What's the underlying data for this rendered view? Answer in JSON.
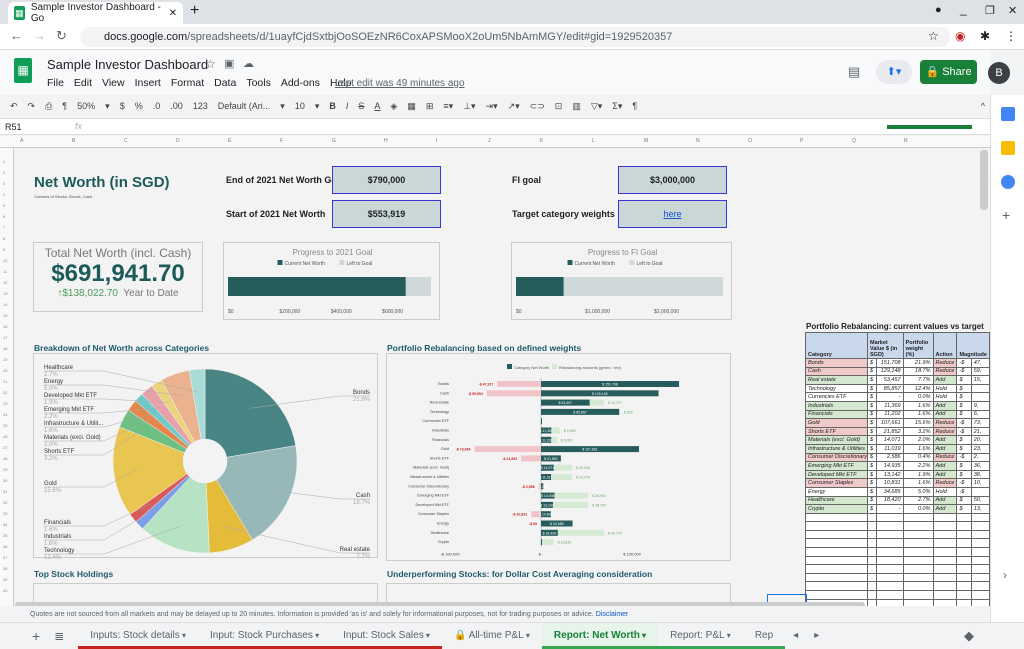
{
  "browser": {
    "tab_title": "Sample Investor Dashboard - Go",
    "url_host": "docs.google.com",
    "url_path": "/spreadsheets/d/1uayfCjdSxtbjOoSOEzNR6CoxAPSMooX2oUm5NbAmMGY/edit#gid=1929520357"
  },
  "doc": {
    "title": "Sample Investor Dashboard",
    "menu": [
      "File",
      "Edit",
      "View",
      "Insert",
      "Format",
      "Data",
      "Tools",
      "Add-ons",
      "Help"
    ],
    "last_edit": "Last edit was 49 minutes ago",
    "share": "Share",
    "avatar": "B"
  },
  "toolbar": {
    "zoom": "50%",
    "currency": "$",
    "percent": "%",
    "dec_less": ".0",
    "dec_more": ".00",
    "format": "123",
    "font": "Default (Ari...",
    "size": "10",
    "bold": "B",
    "italic": "I",
    "strike": "S",
    "textcolor": "A"
  },
  "formula": {
    "cell": "R51",
    "fx": "fx"
  },
  "dashboard": {
    "title": "Net Worth (in SGD)",
    "subtitle": "Consists of Stocks, Bonds, Cash",
    "end_goal_label": "End of 2021 Net Worth Goal",
    "end_goal": "$790,000",
    "start_label": "Start of 2021 Net Worth",
    "start": "$553,919",
    "fi_label": "FI goal",
    "fi": "$3,000,000",
    "weights_label": "Target category weights",
    "weights_link": "here",
    "total_label": "Total Net Worth (incl. Cash)",
    "total": "$691,941.70",
    "ytd_arrow": "↑",
    "ytd": "$138,022.70",
    "ytd_label": "Year to Date",
    "breakdown_title": "Breakdown of Net Worth across Categories",
    "rebal_title": "Portfolio Rebalancing based on defined weights",
    "top_title": "Top Stock Holdings",
    "under_title": "Underperforming Stocks: for Dollar Cost Averaging consideration",
    "table_title": "Portfolio Rebalancing: current values vs target"
  },
  "chart_data": [
    {
      "type": "bar",
      "title": "Progress to 2021 Goal",
      "legend": [
        "Current Net Worth",
        "Left to Goal"
      ],
      "values": [
        691942,
        98058
      ],
      "ticks": [
        "$0",
        "$200,000",
        "$400,000",
        "$600,000"
      ],
      "xlim": [
        0,
        790000
      ],
      "colors": [
        "#265c5c",
        "#d0d9da"
      ]
    },
    {
      "type": "bar",
      "title": "Progress to FI Goal",
      "legend": [
        "Current Net Worth",
        "Left to Goal"
      ],
      "values": [
        691942,
        2308058
      ],
      "ticks": [
        "$0",
        "$1,000,000",
        "$2,000,000"
      ],
      "xlim": [
        0,
        3000000
      ],
      "colors": [
        "#265c5c",
        "#d0d9da"
      ]
    },
    {
      "type": "pie",
      "categories": [
        "Bonds",
        "Cash",
        "Real estate",
        "Technology",
        "Industrials",
        "Financials",
        "Gold",
        "Shorts ETF",
        "Materials (excl. Gold)",
        "Infrastructure & Utilit...",
        "Emerging Mkt ETF",
        "Developed Mkt ETF",
        "Energy",
        "Healthcare"
      ],
      "values": [
        21.9,
        18.7,
        7.7,
        12.4,
        1.6,
        1.6,
        15.6,
        3.2,
        2.0,
        1.6,
        2.2,
        1.9,
        5.0,
        2.7
      ],
      "labels": [
        "21.9%",
        "18.7%",
        "7.7%",
        "12.4%",
        "1.6%",
        "1.6%",
        "15.6%",
        "3.2%",
        "2.0%",
        "1.6%",
        "2.2%",
        "1.9%",
        "5.0%",
        "2.7%"
      ],
      "colors": [
        "#4a8585",
        "#97b8b8",
        "#e5bb3a",
        "#b5e3c3",
        "#7a9ee8",
        "#d95a5a",
        "#e9c552",
        "#6cc081",
        "#e5874d",
        "#6ccbc8",
        "#e8a1a8",
        "#ecd47f",
        "#eab28f",
        "#a9dcd6"
      ]
    },
    {
      "type": "bar",
      "orientation": "horizontal",
      "legend": [
        "Category Net Worth",
        "Rebalancing amounts (green / red)"
      ],
      "xlim": [
        -100000,
        160000
      ],
      "ticks": [
        "-$ 100,000",
        "$ -",
        "$ 100,000"
      ],
      "categories": [
        "Bonds",
        "Cash",
        "Real estate",
        "Technology",
        "Currencies ETF",
        "Industrials",
        "Financials",
        "Gold",
        "Shorts ETF",
        "Materials (excl. Gold)",
        "Infrastructure & Utilities",
        "Consumer Discretionary",
        "Emerging Mkt ETF",
        "Developed Mkt ETF",
        "Consumer Staples",
        "Energy",
        "Healthcare",
        "Crypto"
      ],
      "series": [
        {
          "name": "Category Net Worth",
          "values": [
            151708,
            129148,
            53457,
            85857,
            0,
            11369,
            11202,
            107661,
            21852,
            14071,
            11019,
            2586,
            14935,
            13142,
            10831,
            34685,
            18420,
            0
          ]
        },
        {
          "name": "Rebalancing amounts (green / red)",
          "values": [
            -47917,
            -59554,
            15727,
            836,
            0,
            9369,
            6097,
            -73064,
            -21852,
            20036,
            23078,
            -2586,
            36941,
            38734,
            -10831,
            -69,
            50774,
            13839
          ]
        }
      ]
    }
  ],
  "table": {
    "headers": [
      "Category",
      "Market Value $ (in SGD)",
      "Portfolio weight (%)",
      "Action",
      "Magnitude"
    ],
    "rows": [
      [
        "Bonds",
        "$",
        "151,708",
        "21.9%",
        "Reduce",
        "-$",
        "47,"
      ],
      [
        "Cash",
        "$",
        "129,148",
        "18.7%",
        "Reduce",
        "-$",
        "59,"
      ],
      [
        "Real estate",
        "$",
        "53,457",
        "7.7%",
        "Add",
        "$",
        "15,"
      ],
      [
        "Technology",
        "$",
        "85,857",
        "12.4%",
        "Hold",
        "$",
        ""
      ],
      [
        "Currencies ETF",
        "$",
        "-",
        "0.0%",
        "Hold",
        "$",
        ""
      ],
      [
        "Industrials",
        "$",
        "11,369",
        "1.6%",
        "Add",
        "$",
        "9,"
      ],
      [
        "Financials",
        "$",
        "11,202",
        "1.6%",
        "Add",
        "$",
        "6,"
      ],
      [
        "Gold",
        "$",
        "107,661",
        "15.6%",
        "Reduce",
        "-$",
        "73,"
      ],
      [
        "Shorts ETF",
        "$",
        "21,852",
        "3.2%",
        "Reduce",
        "-$",
        "21,"
      ],
      [
        "Materials (excl. Gold)",
        "$",
        "14,071",
        "2.0%",
        "Add",
        "$",
        "20,"
      ],
      [
        "Infrastructure & Utilities",
        "$",
        "11,019",
        "1.6%",
        "Add",
        "$",
        "23,"
      ],
      [
        "Consumer Discretionary",
        "$",
        "2,586",
        "0.4%",
        "Reduce",
        "-$",
        "2,"
      ],
      [
        "Emerging Mkt ETF",
        "$",
        "14,935",
        "2.2%",
        "Add",
        "$",
        "36,"
      ],
      [
        "Developed Mkt ETF",
        "$",
        "13,142",
        "1.9%",
        "Add",
        "$",
        "38,"
      ],
      [
        "Consumer Staples",
        "$",
        "10,831",
        "1.6%",
        "Reduce",
        "-$",
        "10,"
      ],
      [
        "Energy",
        "$",
        "34,685",
        "5.0%",
        "Hold",
        "-$",
        ""
      ],
      [
        "Healthcare",
        "$",
        "18,420",
        "2.7%",
        "Add",
        "$",
        "50,"
      ],
      [
        "Crypto",
        "$",
        "-",
        "0.0%",
        "Add",
        "$",
        "13,"
      ]
    ]
  },
  "footer": {
    "note": "Quotes are not sourced from all markets and may be delayed up to 20 minutes. Information is provided 'as is' and solely for informational purposes, not for trading purposes or advice.",
    "link": "Disclaimer"
  },
  "sheets": [
    {
      "label": "Inputs: Stock details",
      "color": "#c5221f"
    },
    {
      "label": "Input: Stock Purchases",
      "color": "#c5221f"
    },
    {
      "label": "Input: Stock Sales",
      "color": "#c5221f"
    },
    {
      "label": "All-time P&L",
      "color": ""
    },
    {
      "label": "Report: Net Worth",
      "color": "#34a853",
      "active": true
    },
    {
      "label": "Report: P&L",
      "color": "#34a853"
    },
    {
      "label": "Rep",
      "color": "#34a853"
    }
  ]
}
